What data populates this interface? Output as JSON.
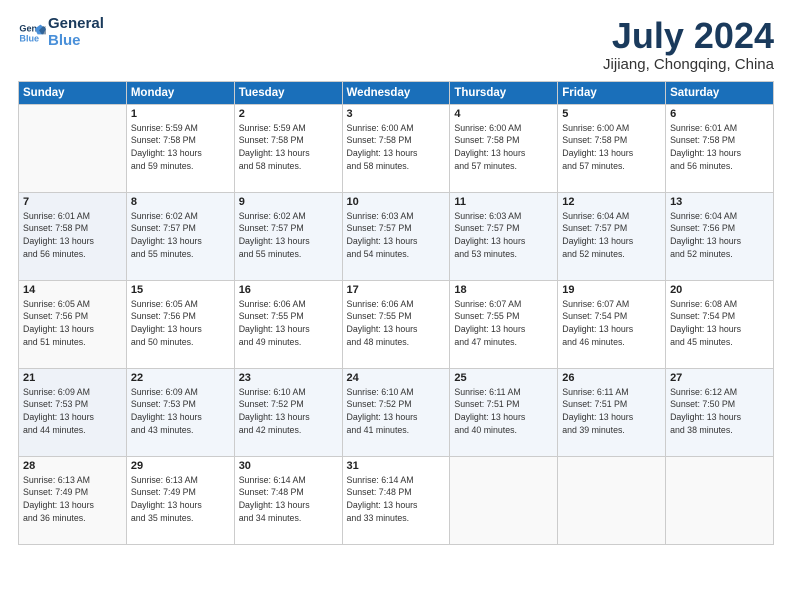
{
  "header": {
    "logo_line1": "General",
    "logo_line2": "Blue",
    "month": "July 2024",
    "location": "Jijiang, Chongqing, China"
  },
  "weekdays": [
    "Sunday",
    "Monday",
    "Tuesday",
    "Wednesday",
    "Thursday",
    "Friday",
    "Saturday"
  ],
  "weeks": [
    [
      {
        "day": "",
        "info": ""
      },
      {
        "day": "1",
        "info": "Sunrise: 5:59 AM\nSunset: 7:58 PM\nDaylight: 13 hours\nand 59 minutes."
      },
      {
        "day": "2",
        "info": "Sunrise: 5:59 AM\nSunset: 7:58 PM\nDaylight: 13 hours\nand 58 minutes."
      },
      {
        "day": "3",
        "info": "Sunrise: 6:00 AM\nSunset: 7:58 PM\nDaylight: 13 hours\nand 58 minutes."
      },
      {
        "day": "4",
        "info": "Sunrise: 6:00 AM\nSunset: 7:58 PM\nDaylight: 13 hours\nand 57 minutes."
      },
      {
        "day": "5",
        "info": "Sunrise: 6:00 AM\nSunset: 7:58 PM\nDaylight: 13 hours\nand 57 minutes."
      },
      {
        "day": "6",
        "info": "Sunrise: 6:01 AM\nSunset: 7:58 PM\nDaylight: 13 hours\nand 56 minutes."
      }
    ],
    [
      {
        "day": "7",
        "info": "Sunrise: 6:01 AM\nSunset: 7:58 PM\nDaylight: 13 hours\nand 56 minutes."
      },
      {
        "day": "8",
        "info": "Sunrise: 6:02 AM\nSunset: 7:57 PM\nDaylight: 13 hours\nand 55 minutes."
      },
      {
        "day": "9",
        "info": "Sunrise: 6:02 AM\nSunset: 7:57 PM\nDaylight: 13 hours\nand 55 minutes."
      },
      {
        "day": "10",
        "info": "Sunrise: 6:03 AM\nSunset: 7:57 PM\nDaylight: 13 hours\nand 54 minutes."
      },
      {
        "day": "11",
        "info": "Sunrise: 6:03 AM\nSunset: 7:57 PM\nDaylight: 13 hours\nand 53 minutes."
      },
      {
        "day": "12",
        "info": "Sunrise: 6:04 AM\nSunset: 7:57 PM\nDaylight: 13 hours\nand 52 minutes."
      },
      {
        "day": "13",
        "info": "Sunrise: 6:04 AM\nSunset: 7:56 PM\nDaylight: 13 hours\nand 52 minutes."
      }
    ],
    [
      {
        "day": "14",
        "info": "Sunrise: 6:05 AM\nSunset: 7:56 PM\nDaylight: 13 hours\nand 51 minutes."
      },
      {
        "day": "15",
        "info": "Sunrise: 6:05 AM\nSunset: 7:56 PM\nDaylight: 13 hours\nand 50 minutes."
      },
      {
        "day": "16",
        "info": "Sunrise: 6:06 AM\nSunset: 7:55 PM\nDaylight: 13 hours\nand 49 minutes."
      },
      {
        "day": "17",
        "info": "Sunrise: 6:06 AM\nSunset: 7:55 PM\nDaylight: 13 hours\nand 48 minutes."
      },
      {
        "day": "18",
        "info": "Sunrise: 6:07 AM\nSunset: 7:55 PM\nDaylight: 13 hours\nand 47 minutes."
      },
      {
        "day": "19",
        "info": "Sunrise: 6:07 AM\nSunset: 7:54 PM\nDaylight: 13 hours\nand 46 minutes."
      },
      {
        "day": "20",
        "info": "Sunrise: 6:08 AM\nSunset: 7:54 PM\nDaylight: 13 hours\nand 45 minutes."
      }
    ],
    [
      {
        "day": "21",
        "info": "Sunrise: 6:09 AM\nSunset: 7:53 PM\nDaylight: 13 hours\nand 44 minutes."
      },
      {
        "day": "22",
        "info": "Sunrise: 6:09 AM\nSunset: 7:53 PM\nDaylight: 13 hours\nand 43 minutes."
      },
      {
        "day": "23",
        "info": "Sunrise: 6:10 AM\nSunset: 7:52 PM\nDaylight: 13 hours\nand 42 minutes."
      },
      {
        "day": "24",
        "info": "Sunrise: 6:10 AM\nSunset: 7:52 PM\nDaylight: 13 hours\nand 41 minutes."
      },
      {
        "day": "25",
        "info": "Sunrise: 6:11 AM\nSunset: 7:51 PM\nDaylight: 13 hours\nand 40 minutes."
      },
      {
        "day": "26",
        "info": "Sunrise: 6:11 AM\nSunset: 7:51 PM\nDaylight: 13 hours\nand 39 minutes."
      },
      {
        "day": "27",
        "info": "Sunrise: 6:12 AM\nSunset: 7:50 PM\nDaylight: 13 hours\nand 38 minutes."
      }
    ],
    [
      {
        "day": "28",
        "info": "Sunrise: 6:13 AM\nSunset: 7:49 PM\nDaylight: 13 hours\nand 36 minutes."
      },
      {
        "day": "29",
        "info": "Sunrise: 6:13 AM\nSunset: 7:49 PM\nDaylight: 13 hours\nand 35 minutes."
      },
      {
        "day": "30",
        "info": "Sunrise: 6:14 AM\nSunset: 7:48 PM\nDaylight: 13 hours\nand 34 minutes."
      },
      {
        "day": "31",
        "info": "Sunrise: 6:14 AM\nSunset: 7:48 PM\nDaylight: 13 hours\nand 33 minutes."
      },
      {
        "day": "",
        "info": ""
      },
      {
        "day": "",
        "info": ""
      },
      {
        "day": "",
        "info": ""
      }
    ]
  ]
}
